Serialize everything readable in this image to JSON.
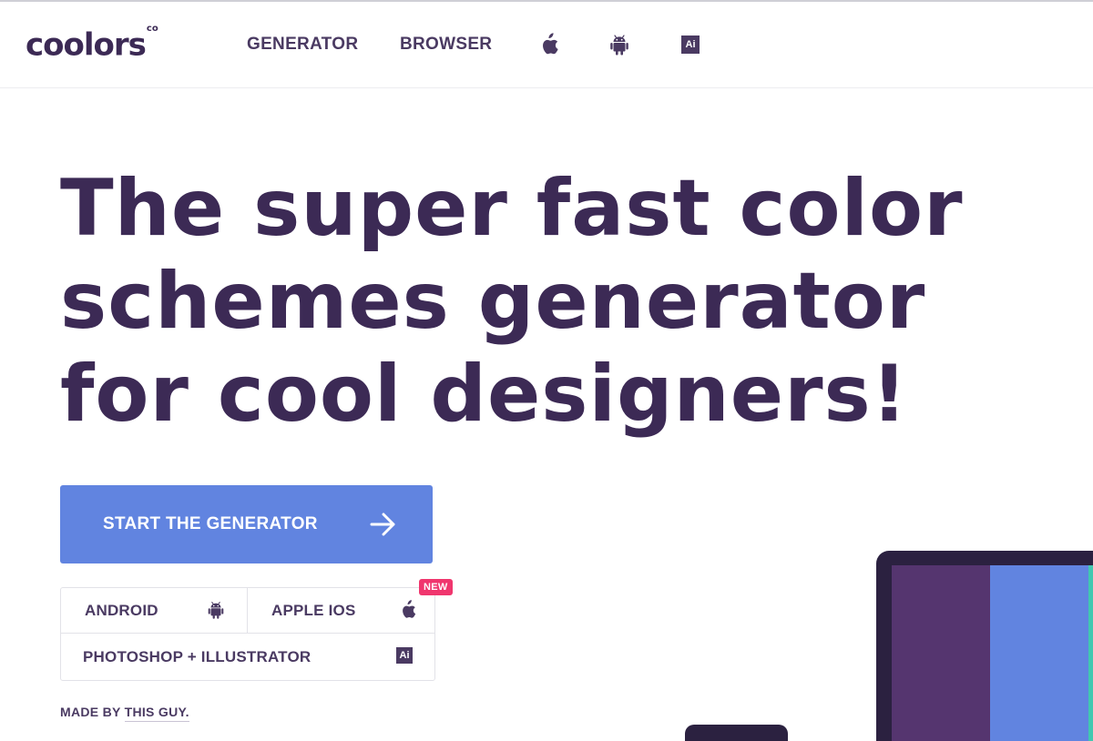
{
  "header": {
    "logo": "coolors",
    "logo_suffix": "co",
    "nav": [
      {
        "label": "GENERATOR"
      },
      {
        "label": "BROWSER"
      }
    ],
    "nav_icons": [
      "apple-icon",
      "android-icon",
      "illustrator-icon"
    ],
    "ai_label": "Ai"
  },
  "hero": {
    "headline_lines": [
      "The super fast color",
      "schemes generator",
      "for cool designers!"
    ]
  },
  "cta": {
    "label": "START THE GENERATOR",
    "icon": "arrow-right-icon"
  },
  "platforms": {
    "android": {
      "label": "ANDROID",
      "icon": "android-icon"
    },
    "ios": {
      "label": "APPLE IOS",
      "icon": "apple-icon",
      "badge": "NEW"
    },
    "photoshop": {
      "label": "PHOTOSHOP + ILLUSTRATOR",
      "icon": "illustrator-icon",
      "ai_label": "Ai"
    }
  },
  "footer": {
    "made_by_prefix": "MADE BY ",
    "made_by_link": "THIS GUY."
  },
  "device_palette": [
    "#55356f",
    "#6184e0",
    "#41c8b0"
  ],
  "colors": {
    "brand_dark": "#3c2a55",
    "cta_blue": "#6184e0",
    "new_badge": "#f0366e",
    "device_frame": "#2b2140"
  }
}
